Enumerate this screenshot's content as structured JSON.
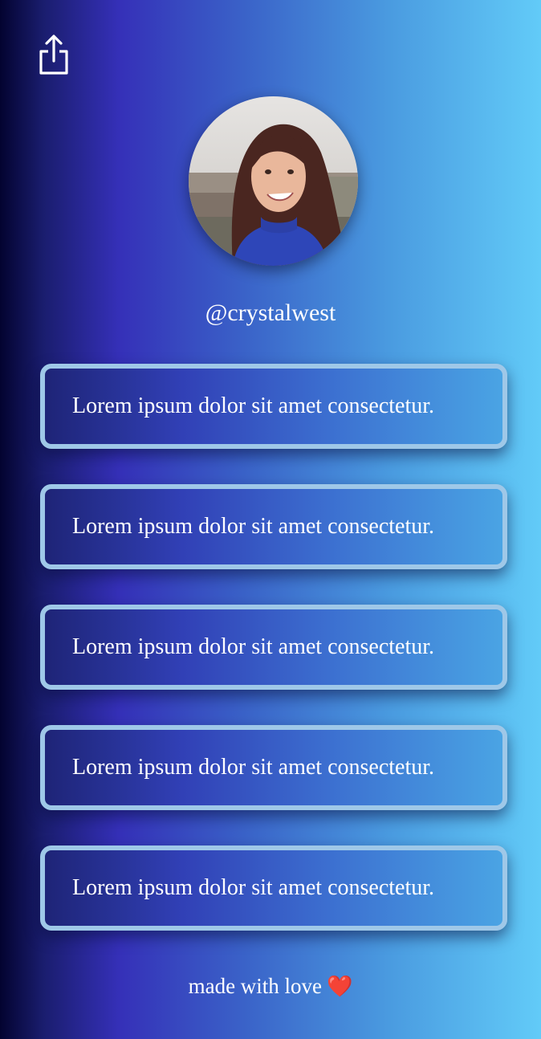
{
  "header": {
    "share_icon": "share-icon"
  },
  "profile": {
    "avatar_icon": "avatar",
    "username": "@crystalwest"
  },
  "links": [
    {
      "label": "Lorem ipsum dolor sit amet consectetur."
    },
    {
      "label": "Lorem ipsum dolor sit amet consectetur."
    },
    {
      "label": "Lorem ipsum dolor sit amet consectetur."
    },
    {
      "label": "Lorem ipsum dolor sit amet consectetur."
    },
    {
      "label": "Lorem ipsum dolor sit amet consectetur."
    }
  ],
  "footer": {
    "text": "made with love",
    "heart": "❤️"
  },
  "colors": {
    "gradient_start": "#030330",
    "gradient_mid": "#3530b8",
    "gradient_end": "#62cbf8",
    "card_border": "#9fc8e8",
    "heart": "#e8202a"
  }
}
